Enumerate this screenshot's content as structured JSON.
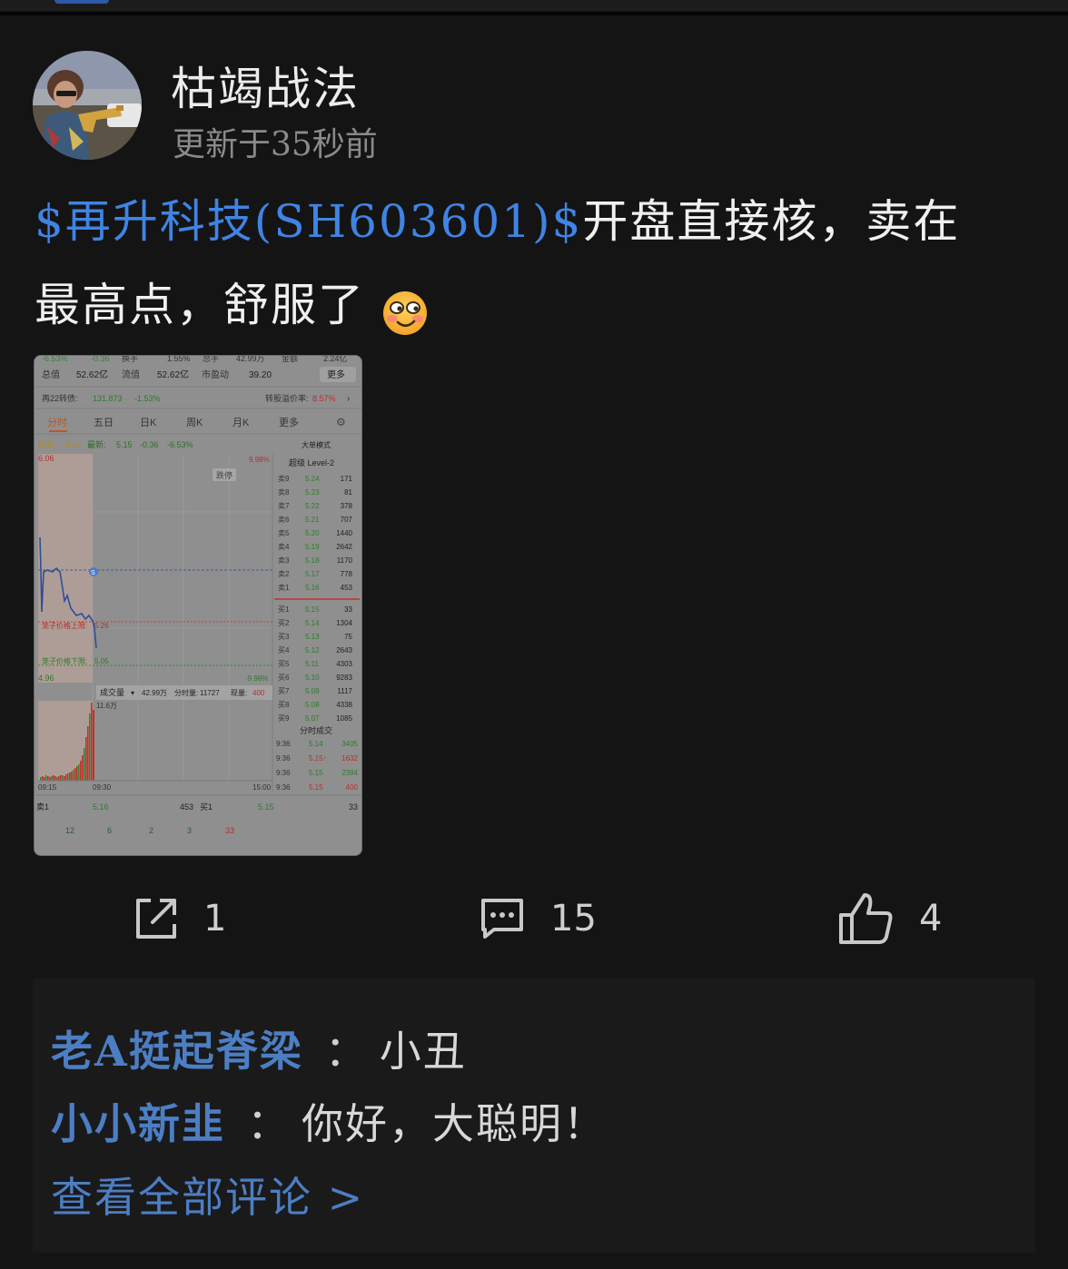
{
  "post": {
    "author": "枯竭战法",
    "updated": "更新于35秒前",
    "stock_link": "$再升科技(SH603601)$",
    "body_line1": "开盘直接核，卖在",
    "body_line2": "最高点，舒服了"
  },
  "thumbnail": {
    "header": {
      "r0": [
        "-6.53%",
        "-0.36",
        "换手",
        "1.55%",
        "总手",
        "42.99万",
        "金额",
        "2.24亿"
      ],
      "total_label": "总值",
      "total": "52.62亿",
      "float_label": "流值",
      "float": "52.62亿",
      "pe_label": "市盈动",
      "pe": "39.20",
      "more": "更多",
      "bond_label": "再22转债:",
      "bond_price": "131.873",
      "bond_change": "-1.53%",
      "premium_label": "转股溢价率:",
      "premium": "8.57%"
    },
    "tabs": [
      "分时",
      "五日",
      "日K",
      "周K",
      "月K",
      "更多"
    ],
    "active_tab": "分时",
    "price_info": {
      "avg_label": "均价:",
      "avg": "5.21",
      "last_label": "最新:",
      "last": "5.15",
      "change": "-0.36",
      "pct": "-6.53%",
      "mode": "大单模式"
    },
    "axis": {
      "high": "6.06",
      "low": "4.96",
      "pct_high": "9.98%",
      "pct_low": "-9.98%",
      "limit_up": "跌停",
      "upper_label": "笼子价格上限:",
      "upper_val": "5.26",
      "lower_label": "笼子价格下限:",
      "lower_val": "5.05",
      "t_start": "09:15",
      "t_mid": "09:30",
      "t_end": "15:00"
    },
    "volume": {
      "label": "成交量",
      "total": "42.99万",
      "minute_label": "分时量:",
      "minute": "11727",
      "current_label": "现量:",
      "current": "400",
      "max": "11.6万"
    },
    "level2_title": "超级 Level-2",
    "asks": [
      {
        "label": "卖9",
        "price": "5.24",
        "vol": "171"
      },
      {
        "label": "卖8",
        "price": "5.23",
        "vol": "81"
      },
      {
        "label": "卖7",
        "price": "5.22",
        "vol": "378"
      },
      {
        "label": "卖6",
        "price": "5.21",
        "vol": "707"
      },
      {
        "label": "卖5",
        "price": "5.20",
        "vol": "1440"
      },
      {
        "label": "卖4",
        "price": "5.19",
        "vol": "2642"
      },
      {
        "label": "卖3",
        "price": "5.18",
        "vol": "1170"
      },
      {
        "label": "卖2",
        "price": "5.17",
        "vol": "778"
      },
      {
        "label": "卖1",
        "price": "5.16",
        "vol": "453"
      }
    ],
    "bids": [
      {
        "label": "买1",
        "price": "5.15",
        "vol": "33"
      },
      {
        "label": "买2",
        "price": "5.14",
        "vol": "1304"
      },
      {
        "label": "买3",
        "price": "5.13",
        "vol": "75"
      },
      {
        "label": "买4",
        "price": "5.12",
        "vol": "2643"
      },
      {
        "label": "买5",
        "price": "5.11",
        "vol": "4303"
      },
      {
        "label": "买6",
        "price": "5.10",
        "vol": "9283"
      },
      {
        "label": "买7",
        "price": "5.09",
        "vol": "1117"
      },
      {
        "label": "买8",
        "price": "5.08",
        "vol": "4338"
      },
      {
        "label": "买9",
        "price": "5.07",
        "vol": "1085"
      }
    ],
    "ticks_title": "分时成交",
    "ticks": [
      {
        "time": "9:36",
        "price": "5.14",
        "vol": "3405",
        "up": false
      },
      {
        "time": "9:36",
        "price": "5.15↑",
        "vol": "1632",
        "up": true
      },
      {
        "time": "9:36",
        "price": "5.15",
        "vol": "2394",
        "up": false
      },
      {
        "time": "9:36",
        "price": "5.15",
        "vol": "400",
        "up": true
      }
    ],
    "bottom": {
      "sell_label": "卖1",
      "sell_price": "5.16",
      "sell_vol": "453",
      "buy_label": "买1",
      "buy_price": "5.15",
      "buy_vol": "33",
      "q": [
        "12",
        "6",
        "2",
        "3",
        "33"
      ]
    }
  },
  "actions": {
    "share_count": "1",
    "comment_count": "15",
    "like_count": "4"
  },
  "comments": {
    "items": [
      {
        "user": "老A挺起脊梁",
        "sep": "：",
        "text": "小丑"
      },
      {
        "user": "小小新韭",
        "sep": "：",
        "text": "你好，大聪明！"
      }
    ],
    "view_all": "查看全部评论 >"
  },
  "colors": {
    "background": "#141414",
    "link_blue": "#3f84e5",
    "comment_user_blue": "#4c7ec4",
    "up_red": "#d63a2f",
    "down_green": "#2f9e3a"
  }
}
